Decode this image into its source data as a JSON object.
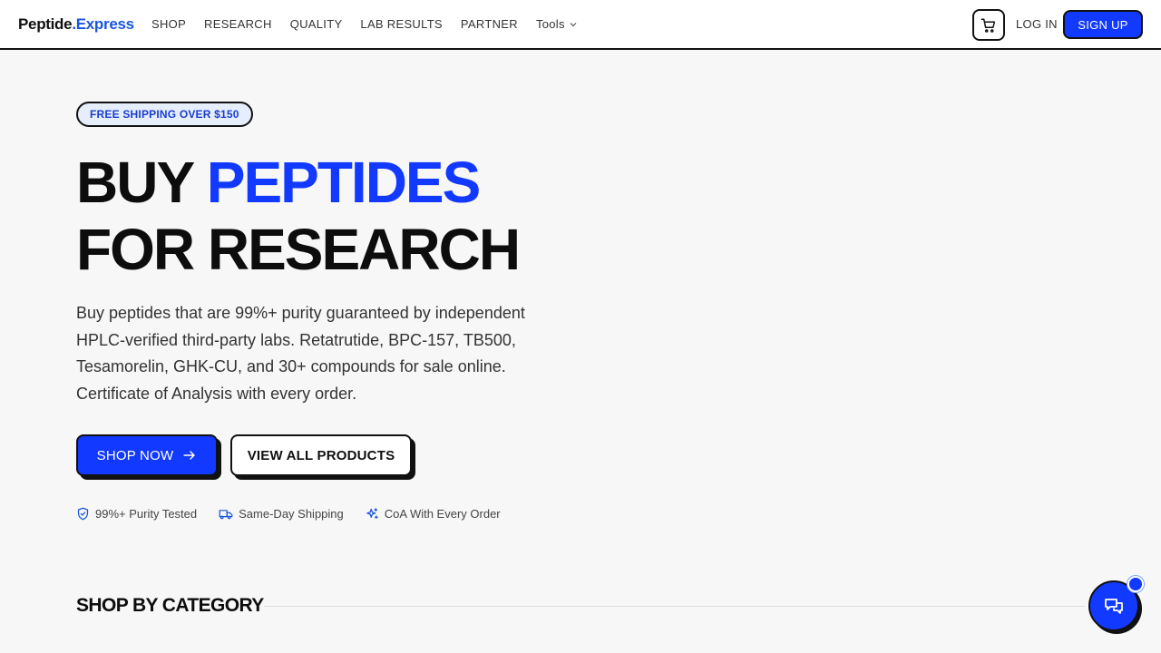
{
  "logo": {
    "brand": "Peptide",
    "suffix": ".Express"
  },
  "nav": {
    "items": [
      "SHOP",
      "RESEARCH",
      "QUALITY",
      "LAB RESULTS",
      "PARTNER"
    ],
    "tools": "Tools",
    "login": "LOG IN",
    "signup": "SIGN UP"
  },
  "hero": {
    "badge": "FREE SHIPPING OVER $150",
    "title_line1_a": "BUY ",
    "title_line1_b": "PEPTIDES",
    "title_line2": "FOR RESEARCH",
    "lead": "Buy peptides that are 99%+ purity guaranteed by independent HPLC-verified third-party labs. Retatrutide, BPC-157, TB500, Tesamorelin, GHK-CU, and 30+ compounds for sale online. Certificate of Analysis with every order.",
    "primary_cta": "SHOP NOW",
    "secondary_cta": "VIEW ALL PRODUCTS"
  },
  "features": [
    {
      "icon": "shield-check-icon",
      "label": "99%+ Purity Tested"
    },
    {
      "icon": "truck-icon",
      "label": "Same-Day Shipping"
    },
    {
      "icon": "sparkles-icon",
      "label": "CoA With Every Order"
    }
  ],
  "section": {
    "title": "SHOP BY CATEGORY"
  },
  "colors": {
    "accent": "#1239ff",
    "logo_accent": "#1a56db",
    "text": "#111111",
    "background": "#f7f7f8"
  }
}
